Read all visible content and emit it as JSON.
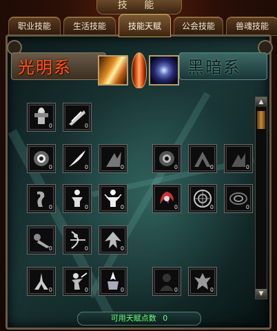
{
  "window": {
    "title": "技 能"
  },
  "tabs": [
    {
      "label": "职业技能",
      "active": false
    },
    {
      "label": "生活技能",
      "active": false
    },
    {
      "label": "技能天赋",
      "active": true
    },
    {
      "label": "公会技能",
      "active": false
    },
    {
      "label": "兽魂技能",
      "active": false
    }
  ],
  "header": {
    "light_label": "光明系",
    "dark_label": "黑暗系"
  },
  "skills": {
    "light": [
      {
        "icon": "armor-figure-icon",
        "count": "0"
      },
      {
        "icon": "claw-strike-icon",
        "count": "0"
      },
      {
        "icon": "eye-orb-icon",
        "count": "0"
      },
      {
        "icon": "slash-icon",
        "count": "0"
      },
      {
        "icon": "dark-slash-icon",
        "count": "0"
      },
      {
        "icon": "rune-icon",
        "count": "0"
      },
      {
        "icon": "standing-figure-icon",
        "count": "0"
      },
      {
        "icon": "glowing-figure-icon",
        "count": "0"
      },
      {
        "icon": "charge-icon",
        "count": "0"
      },
      {
        "icon": "archer-icon",
        "count": "0"
      },
      {
        "icon": "winged-icon",
        "count": "0"
      },
      {
        "icon": "crossed-hands-icon",
        "count": "0"
      },
      {
        "icon": "warrior-icon",
        "count": "0"
      },
      {
        "icon": "holy-icon",
        "count": "0"
      }
    ],
    "dark": [
      {
        "icon": "dark-eye-icon",
        "count": "0"
      },
      {
        "icon": "shadow-peak-icon",
        "count": "0"
      },
      {
        "icon": "shadow-claw-icon",
        "count": "0"
      },
      {
        "icon": "red-claw-icon",
        "count": "0"
      },
      {
        "icon": "compass-icon",
        "count": "0"
      },
      {
        "icon": "swirl-icon",
        "count": "0"
      },
      {
        "icon": "silhouette-icon",
        "count": "0"
      },
      {
        "icon": "demon-icon",
        "count": "0"
      }
    ]
  },
  "footer": {
    "label": "可用天赋点数",
    "value": "0"
  },
  "scrollbar": {
    "up": "▲",
    "down": "▼"
  }
}
